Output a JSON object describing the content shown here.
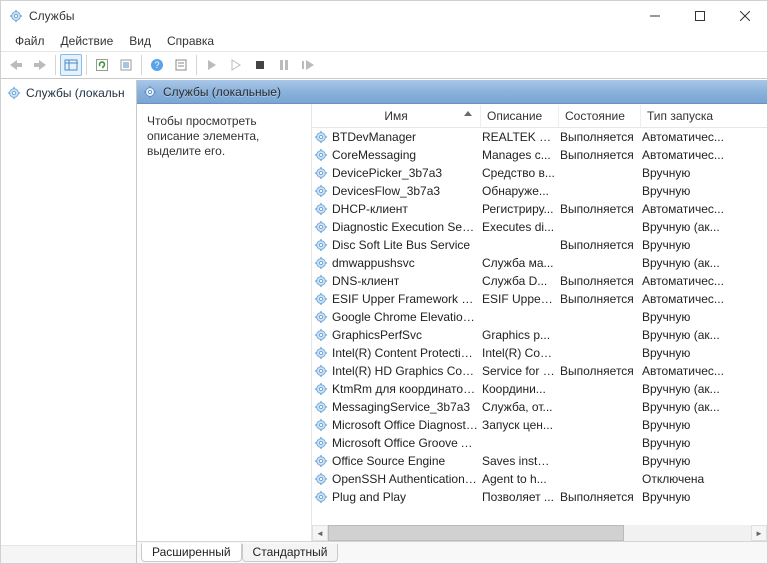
{
  "window": {
    "title": "Службы"
  },
  "menu": {
    "file": "Файл",
    "action": "Действие",
    "view": "Вид",
    "help": "Справка"
  },
  "tree": {
    "root": "Службы (локальн"
  },
  "right_header": {
    "title": "Службы (локальные)"
  },
  "desc_panel": {
    "text": "Чтобы просмотреть описание элемента, выделите его."
  },
  "columns": {
    "name": "Имя",
    "description": "Описание",
    "state": "Состояние",
    "start_type": "Тип запуска"
  },
  "tabs": {
    "extended": "Расширенный",
    "standard": "Стандартный"
  },
  "services": [
    {
      "name": "BTDevManager",
      "description": "REALTEK Bl...",
      "state": "Выполняется",
      "start_type": "Автоматичес..."
    },
    {
      "name": "CoreMessaging",
      "description": "Manages c...",
      "state": "Выполняется",
      "start_type": "Автоматичес..."
    },
    {
      "name": "DevicePicker_3b7a3",
      "description": "Средство в...",
      "state": "",
      "start_type": "Вручную"
    },
    {
      "name": "DevicesFlow_3b7a3",
      "description": "Обнаруже...",
      "state": "",
      "start_type": "Вручную"
    },
    {
      "name": "DHCP-клиент",
      "description": "Регистриру...",
      "state": "Выполняется",
      "start_type": "Автоматичес..."
    },
    {
      "name": "Diagnostic Execution Service",
      "description": "Executes di...",
      "state": "",
      "start_type": "Вручную (ак..."
    },
    {
      "name": "Disc Soft Lite Bus Service",
      "description": "",
      "state": "Выполняется",
      "start_type": "Вручную"
    },
    {
      "name": "dmwappushsvc",
      "description": "Служба ма...",
      "state": "",
      "start_type": "Вручную (ак..."
    },
    {
      "name": "DNS-клиент",
      "description": "Служба D...",
      "state": "Выполняется",
      "start_type": "Автоматичес..."
    },
    {
      "name": "ESIF Upper Framework Service",
      "description": "ESIF Upper ...",
      "state": "Выполняется",
      "start_type": "Автоматичес..."
    },
    {
      "name": "Google Chrome Elevation Se...",
      "description": "",
      "state": "",
      "start_type": "Вручную"
    },
    {
      "name": "GraphicsPerfSvc",
      "description": "Graphics p...",
      "state": "",
      "start_type": "Вручную (ак..."
    },
    {
      "name": "Intel(R) Content Protection H...",
      "description": "Intel(R) Con...",
      "state": "",
      "start_type": "Вручную"
    },
    {
      "name": "Intel(R) HD Graphics Control ...",
      "description": "Service for I...",
      "state": "Выполняется",
      "start_type": "Автоматичес..."
    },
    {
      "name": "KtmRm для координатора ...",
      "description": "Координи...",
      "state": "",
      "start_type": "Вручную (ак..."
    },
    {
      "name": "MessagingService_3b7a3",
      "description": "Служба, от...",
      "state": "",
      "start_type": "Вручную (ак..."
    },
    {
      "name": "Microsoft Office Diagnostics...",
      "description": "Запуск цен...",
      "state": "",
      "start_type": "Вручную"
    },
    {
      "name": "Microsoft Office Groove Au...",
      "description": "",
      "state": "",
      "start_type": "Вручную"
    },
    {
      "name": "Office  Source Engine",
      "description": "Saves instal...",
      "state": "",
      "start_type": "Вручную"
    },
    {
      "name": "OpenSSH Authentication Ag...",
      "description": "Agent to h...",
      "state": "",
      "start_type": "Отключена"
    },
    {
      "name": "Plug and Play",
      "description": "Позволяет ...",
      "state": "Выполняется",
      "start_type": "Вручную"
    }
  ]
}
